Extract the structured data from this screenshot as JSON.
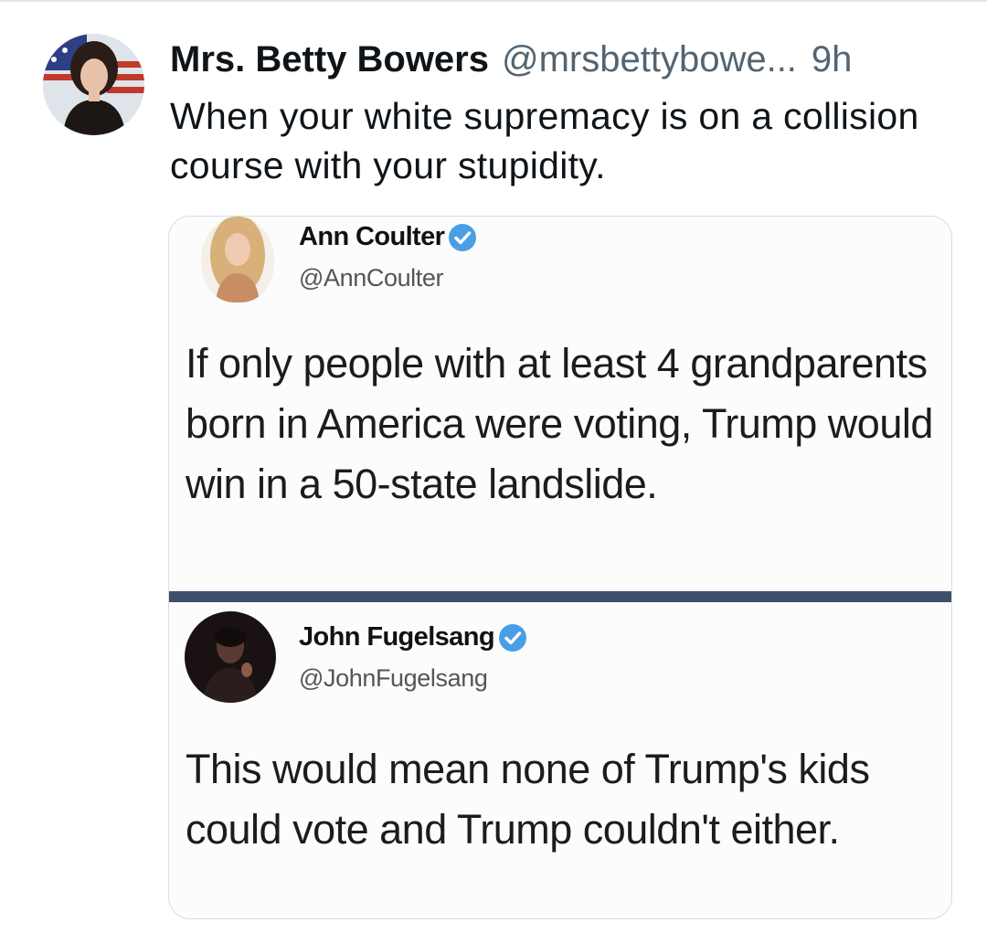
{
  "tweet": {
    "author_name": "Mrs. Betty Bowers",
    "author_handle": "@mrsbettybowe...",
    "separator": "",
    "time": "9h",
    "text": "When your white supremacy is on a collision course with your stupidity."
  },
  "quoted_image": {
    "first": {
      "name": "Ann Coulter",
      "handle": "@AnnCoulter",
      "text": "If only people with at least 4 grandparents born in America were voting, Trump would win in a 50-state landslide."
    },
    "second": {
      "name": "John Fugelsang",
      "handle": "@JohnFugelsang",
      "text": "This would mean none of Trump's kids could vote and Trump couldn't either."
    }
  },
  "icons": {
    "verified": "verified-badge-icon",
    "verified_color": "#4a9ee6"
  },
  "colors": {
    "divider": "#3d4f6b",
    "secondary_text": "#536471"
  }
}
